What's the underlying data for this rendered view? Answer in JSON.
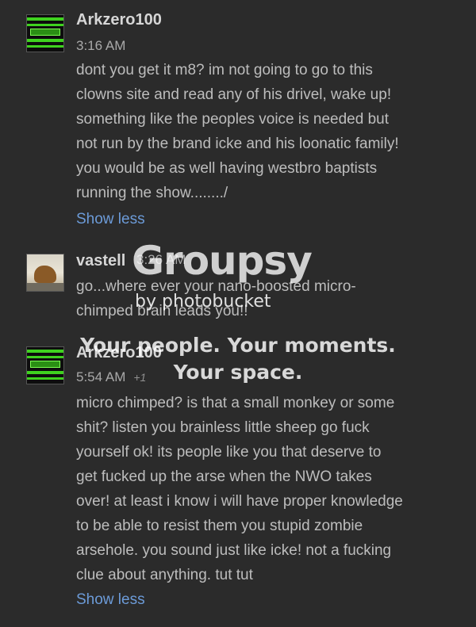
{
  "comments": [
    {
      "username": "Arkzero100",
      "time": "3:16 AM",
      "avatar": "green-striped-avatar",
      "text": "dont you get it m8? im not going to go to this\nclowns site and read any of his drivel, wake up!\nsomething like the peoples voice is needed but\nnot run by the brand icke and his loonatic family!\nyou would be as well having westbro baptists\nrunning the show......../",
      "toggle": "Show less"
    },
    {
      "username": "vastell",
      "time": "3:26 AM",
      "avatar": "dog-photo-avatar",
      "text": "go...where ever your nano-boosted micro-\nchimped brain leads you!!"
    },
    {
      "username": "Arkzero100",
      "time": "5:54 AM",
      "plus_one": "+1",
      "avatar": "green-striped-avatar",
      "text": "micro chimped? is that a small monkey or some\nshit? listen you brainless little sheep go fuck\nyourself ok! its people like you that deserve to\nget fucked up the arse when the NWO takes\nover! at least i know i will have proper knowledge\nto be able to resist them you stupid zombie\narsehole. you sound just like icke! not a fucking\nclue about anything. tut tut",
      "toggle": "Show less"
    }
  ],
  "watermark": {
    "logo": "Groupsy",
    "byline": "by photobucket",
    "tagline_1": "Your people. Your moments.",
    "tagline_2": "Your space."
  }
}
